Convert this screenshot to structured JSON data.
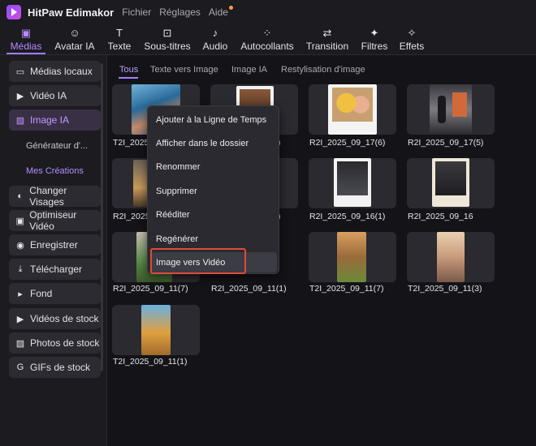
{
  "titlebar": {
    "app_name": "HitPaw Edimakor",
    "menus": [
      "Fichier",
      "Réglages",
      "Aide"
    ]
  },
  "toolbar": {
    "tools": [
      {
        "label": "Médias",
        "icon": "media-icon",
        "glyph": "▣",
        "active": true
      },
      {
        "label": "Avatar IA",
        "icon": "avatar-icon",
        "glyph": "☺",
        "active": false
      },
      {
        "label": "Texte",
        "icon": "text-icon",
        "glyph": "T",
        "active": false
      },
      {
        "label": "Sous-titres",
        "icon": "subtitles-icon",
        "glyph": "⊡",
        "active": false
      },
      {
        "label": "Audio",
        "icon": "audio-icon",
        "glyph": "♪",
        "active": false
      },
      {
        "label": "Autocollants",
        "icon": "stickers-icon",
        "glyph": "⁘",
        "active": false
      },
      {
        "label": "Transition",
        "icon": "transition-icon",
        "glyph": "⇄",
        "active": false
      },
      {
        "label": "Filtres",
        "icon": "filters-icon",
        "glyph": "✦",
        "active": false
      },
      {
        "label": "Effets",
        "icon": "effects-icon",
        "glyph": "✧",
        "active": false
      }
    ]
  },
  "sidebar": {
    "items": [
      {
        "label": "Médias locaux",
        "icon": "folder-icon",
        "glyph": "▭"
      },
      {
        "label": "Vidéo IA",
        "icon": "video-ai-icon",
        "glyph": "▶"
      },
      {
        "label": "Image IA",
        "icon": "image-ai-icon",
        "glyph": "▨"
      },
      {
        "label": "Changer Visages",
        "icon": "face-swap-icon",
        "glyph": "◐"
      },
      {
        "label": "Optimiseur Vidéo",
        "icon": "video-enhancer-icon",
        "glyph": "▣"
      },
      {
        "label": "Enregistrer",
        "icon": "record-icon",
        "glyph": "◉"
      },
      {
        "label": "Télécharger",
        "icon": "download-icon",
        "glyph": "⤓"
      },
      {
        "label": "Fond",
        "icon": "background-icon",
        "glyph": "▸"
      },
      {
        "label": "Vidéos de stock",
        "icon": "stock-video-icon",
        "glyph": "▶"
      },
      {
        "label": "Photos de stock",
        "icon": "stock-photo-icon",
        "glyph": "▨"
      },
      {
        "label": "GIFs de stock",
        "icon": "gif-icon",
        "glyph": "G"
      }
    ],
    "sub_items": [
      "Générateur d'...",
      "Mes Créations"
    ]
  },
  "tabs": [
    "Tous",
    "Texte vers Image",
    "Image IA",
    "Restylisation d'image"
  ],
  "thumbnails": [
    {
      "caption": "T2I_2025_"
    },
    {
      "caption": ")"
    },
    {
      "caption": "R2I_2025_09_17(6)"
    },
    {
      "caption": "R2I_2025_09_17(5)"
    },
    {
      "caption": "R2I_2025_"
    },
    {
      "caption": ")"
    },
    {
      "caption": "R2I_2025_09_16(1)"
    },
    {
      "caption": "R2I_2025_09_16"
    },
    {
      "caption": "R2I_2025_09_11(7)"
    },
    {
      "caption": "R2I_2025_09_11(1)"
    },
    {
      "caption": "T2I_2025_09_11(7)"
    },
    {
      "caption": "T2I_2025_09_11(3)"
    },
    {
      "caption": "T2I_2025_09_11(1)"
    }
  ],
  "context_menu": {
    "items": [
      "Ajouter à la Ligne de Temps",
      "Afficher dans le dossier",
      "Renommer",
      "Supprimer",
      "Rééditer",
      "Regénérer",
      "Image vers Vidéo"
    ]
  },
  "colors": {
    "accent": "#a97bff",
    "highlight_border": "#e04a3a",
    "background": "#141418",
    "panel": "#1b1b20"
  }
}
